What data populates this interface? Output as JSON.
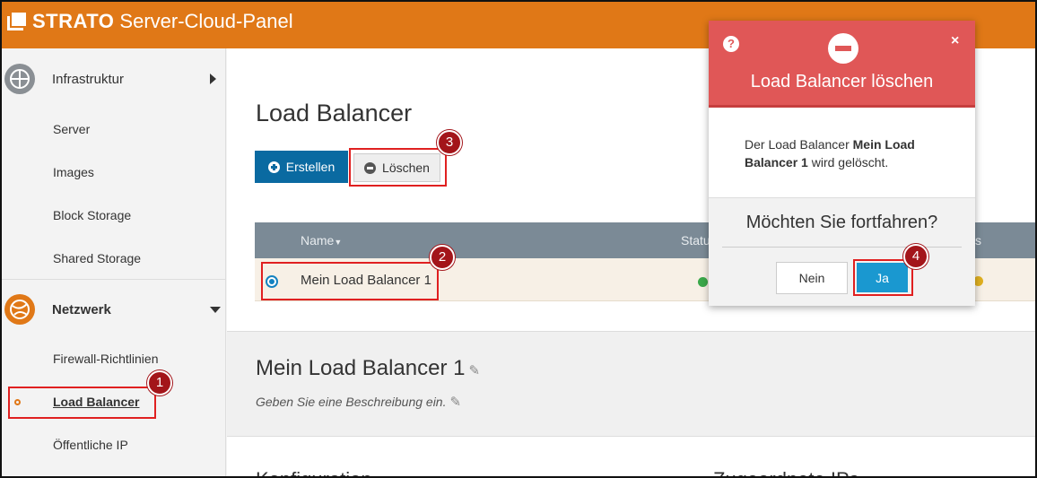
{
  "header": {
    "brand": "STRATO",
    "product": "Server-Cloud-Panel"
  },
  "sidebar": {
    "categories": [
      {
        "label": "Infrastruktur",
        "icon": "globe-icon",
        "expanded": false
      },
      {
        "label": "Netzwerk",
        "icon": "network-globe-icon",
        "expanded": true
      }
    ],
    "infra_items": [
      "Server",
      "Images",
      "Block Storage",
      "Shared Storage"
    ],
    "network_items": [
      "Firewall-Richtlinien",
      "Load Balancer",
      "Öffentliche IP"
    ],
    "active_item": "Load Balancer"
  },
  "main": {
    "title": "Load Balancer",
    "create_label": "Erstellen",
    "delete_label": "Löschen",
    "table": {
      "col_name": "Name",
      "col_status": "Statu",
      "col_right": "s",
      "rows": [
        {
          "name": "Mein Load Balancer 1"
        }
      ]
    },
    "detail": {
      "title": "Mein Load Balancer 1",
      "description_placeholder": "Geben Sie eine Beschreibung ein."
    },
    "cut_left": "Konfiguration",
    "cut_right": "Zugeordnete IPs"
  },
  "modal": {
    "title": "Load Balancer löschen",
    "message_prefix": "Der Load Balancer ",
    "message_name": "Mein Load Balancer 1",
    "message_suffix": " wird gelöscht.",
    "question": "Möchten Sie fortfahren?",
    "no_label": "Nein",
    "yes_label": "Ja",
    "help_glyph": "?",
    "close_glyph": "×"
  },
  "annotations": [
    "1",
    "2",
    "3",
    "4"
  ],
  "colors": {
    "brand_orange": "#e07817",
    "primary_blue": "#0a6aa1",
    "modal_red": "#e05757",
    "highlight_red": "#e02020",
    "badge_red": "#a3151a"
  }
}
